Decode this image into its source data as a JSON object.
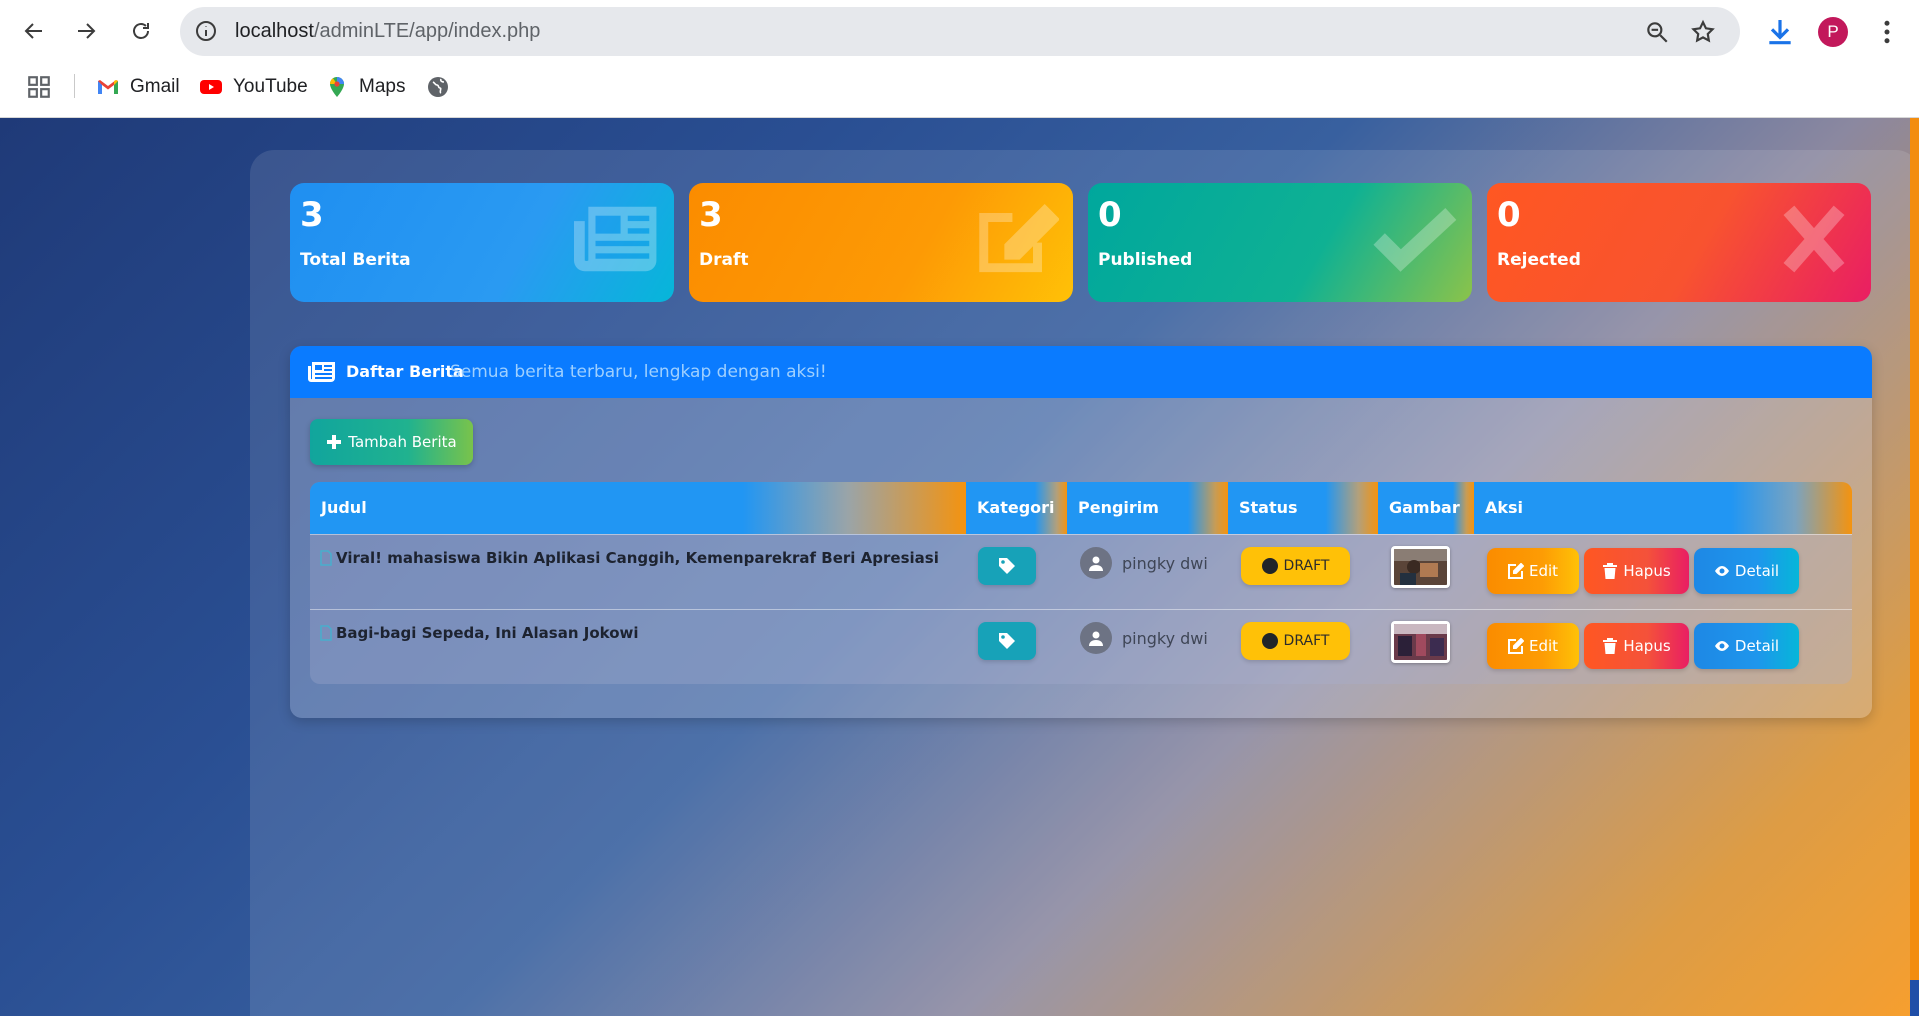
{
  "browser": {
    "url_host": "localhost",
    "url_path": "/adminLTE/app/index.php",
    "profile_initial": "P",
    "bookmarks": [
      {
        "label": "Gmail"
      },
      {
        "label": "YouTube"
      },
      {
        "label": "Maps"
      }
    ]
  },
  "stats": [
    {
      "value": "3",
      "label": "Total Berita",
      "icon": "newspaper-icon"
    },
    {
      "value": "3",
      "label": "Draft",
      "icon": "edit-icon"
    },
    {
      "value": "0",
      "label": "Published",
      "icon": "check-icon"
    },
    {
      "value": "0",
      "label": "Rejected",
      "icon": "times-icon"
    }
  ],
  "list": {
    "title": "Daftar Berita",
    "subtitle": "Semua berita terbaru, lengkap dengan aksi!",
    "add_button": "Tambah Berita",
    "columns": {
      "judul": "Judul",
      "kategori": "Kategori",
      "pengirim": "Pengirim",
      "status": "Status",
      "gambar": "Gambar",
      "aksi": "Aksi"
    },
    "rows": [
      {
        "title": "Viral! mahasiswa Bikin Aplikasi Canggih, Kemenparekraf Beri Apresiasi",
        "sender": "pingky dwi",
        "status": "DRAFT",
        "edit": "Edit",
        "hapus": "Hapus",
        "detail": "Detail"
      },
      {
        "title": "Bagi-bagi Sepeda, Ini Alasan Jokowi",
        "sender": "pingky dwi",
        "status": "DRAFT",
        "edit": "Edit",
        "hapus": "Hapus",
        "detail": "Detail"
      }
    ]
  },
  "colors": {
    "header_blue": "#0a7bff",
    "stat_blue": "#2196f3",
    "stat_orange": "#fb8c00",
    "stat_green": "#00a79d",
    "stat_red": "#ff5722",
    "draft_badge": "#ffc107"
  }
}
